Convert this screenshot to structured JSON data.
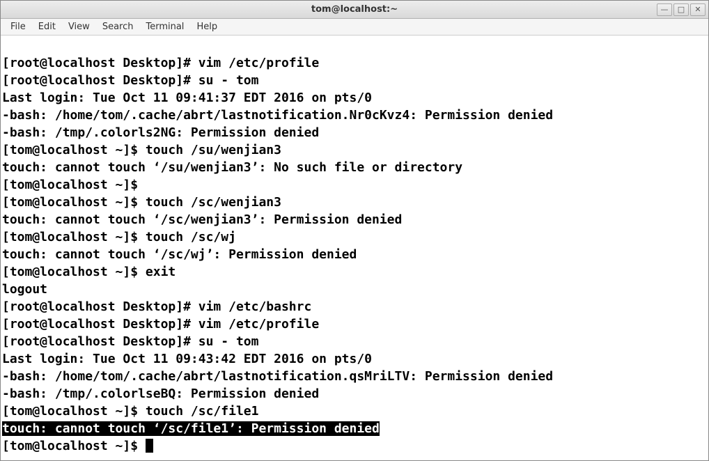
{
  "window": {
    "title": "tom@localhost:~"
  },
  "menu": {
    "file": "File",
    "edit": "Edit",
    "view": "View",
    "search": "Search",
    "terminal": "Terminal",
    "help": "Help"
  },
  "lines": {
    "l0": "[root@localhost Desktop]# vim /etc/profile",
    "l1": "[root@localhost Desktop]# su - tom",
    "l2": "Last login: Tue Oct 11 09:41:37 EDT 2016 on pts/0",
    "l3": "-bash: /home/tom/.cache/abrt/lastnotification.Nr0cKvz4: Permission denied",
    "l4": "-bash: /tmp/.colorls2NG: Permission denied",
    "l5": "[tom@localhost ~]$ touch /su/wenjian3",
    "l6": "touch: cannot touch ‘/su/wenjian3’: No such file or directory",
    "l7": "[tom@localhost ~]$ ",
    "l8": "[tom@localhost ~]$ touch /sc/wenjian3",
    "l9": "touch: cannot touch ‘/sc/wenjian3’: Permission denied",
    "l10": "[tom@localhost ~]$ touch /sc/wj",
    "l11": "touch: cannot touch ‘/sc/wj’: Permission denied",
    "l12": "[tom@localhost ~]$ exit",
    "l13": "logout",
    "l14": "[root@localhost Desktop]# vim /etc/bashrc",
    "l15": "[root@localhost Desktop]# vim /etc/profile",
    "l16": "[root@localhost Desktop]# su - tom",
    "l17": "Last login: Tue Oct 11 09:43:42 EDT 2016 on pts/0",
    "l18": "-bash: /home/tom/.cache/abrt/lastnotification.qsMriLTV: Permission denied",
    "l19": "-bash: /tmp/.colorlseBQ: Permission denied",
    "l20": "[tom@localhost ~]$ touch /sc/file1",
    "l21": "touch: cannot touch ‘/sc/file1’: Permission denied",
    "l22": "[tom@localhost ~]$ "
  }
}
